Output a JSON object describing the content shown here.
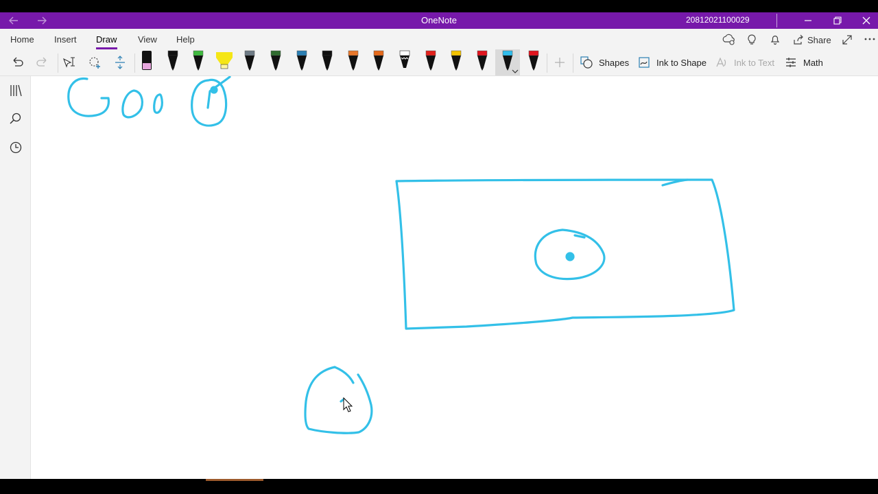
{
  "app": {
    "title": "OneNote",
    "doc_id": "20812021100029"
  },
  "ribbon": {
    "tabs": [
      {
        "label": "Home"
      },
      {
        "label": "Insert"
      },
      {
        "label": "Draw",
        "active": true
      },
      {
        "label": "View"
      },
      {
        "label": "Help"
      }
    ],
    "share_label": "Share",
    "shapes_label": "Shapes",
    "ink_to_shape_label": "Ink to Shape",
    "ink_to_text_label": "Ink to Text",
    "math_label": "Math",
    "pens": [
      {
        "name": "pink-highlighter",
        "color": "#e7a6dd"
      },
      {
        "name": "black-pen",
        "color": "#111111"
      },
      {
        "name": "green-pen",
        "color": "#3fb93f"
      },
      {
        "name": "yellow-highlighter",
        "color": "#f5e616"
      },
      {
        "name": "gray-pencil",
        "color": "#6f7c86"
      },
      {
        "name": "galaxy-pen",
        "color": "#2f6b2f"
      },
      {
        "name": "ocean-pen",
        "color": "#2b7fb3"
      },
      {
        "name": "black-pen-2",
        "color": "#111111"
      },
      {
        "name": "orange-pen",
        "color": "#e8782b"
      },
      {
        "name": "orange-pen-2",
        "color": "#e46a1c"
      },
      {
        "name": "white-pen",
        "color": "#ffffff"
      },
      {
        "name": "red-pen",
        "color": "#e2211c"
      },
      {
        "name": "gold-pen",
        "color": "#f2c200"
      },
      {
        "name": "red-pen-2",
        "color": "#e0141e"
      },
      {
        "name": "cyan-pen",
        "color": "#2fbdec",
        "selected": true
      },
      {
        "name": "red-pen-3",
        "color": "#e0141e"
      }
    ]
  },
  "colors": {
    "accent": "#7719aa",
    "ink": "#2fbdec"
  }
}
